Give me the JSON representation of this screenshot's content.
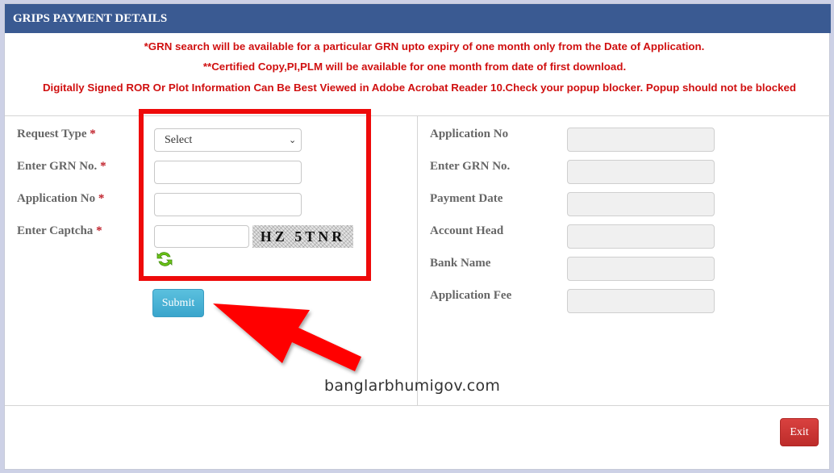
{
  "header": {
    "title": "GRIPS PAYMENT DETAILS"
  },
  "notices": [
    "*GRN search will be available for a particular GRN upto expiry of one month only from the Date of Application.",
    "**Certified Copy,PI,PLM will be available for one month from date of first download.",
    "Digitally Signed ROR Or Plot Information Can Be Best Viewed in Adobe Acrobat Reader 10.Check your popup blocker. Popup should not be blocked"
  ],
  "form": {
    "required_marker": "*",
    "request_type": {
      "label": "Request Type",
      "selected": "Select",
      "options": [
        "Select"
      ]
    },
    "grn_no": {
      "label": "Enter GRN No.",
      "value": ""
    },
    "application_no": {
      "label": "Application No",
      "value": ""
    },
    "captcha": {
      "label": "Enter Captcha",
      "value": "",
      "image_text": "HZ 5TNR"
    },
    "submit_label": "Submit"
  },
  "details": {
    "fields": [
      {
        "label": "Application No",
        "value": ""
      },
      {
        "label": "Enter GRN No.",
        "value": ""
      },
      {
        "label": "Payment Date",
        "value": ""
      },
      {
        "label": "Account Head",
        "value": ""
      },
      {
        "label": "Bank Name",
        "value": ""
      },
      {
        "label": "Application Fee",
        "value": ""
      }
    ]
  },
  "footer": {
    "exit_label": "Exit"
  },
  "overlay": {
    "watermark": "banglarbhumigov.com"
  },
  "colors": {
    "header_bg": "#3a5a92",
    "notice_text": "#d01010",
    "submit_bg": "#5bc0de",
    "exit_bg": "#d9413f",
    "highlight": "#ee0a0a"
  }
}
